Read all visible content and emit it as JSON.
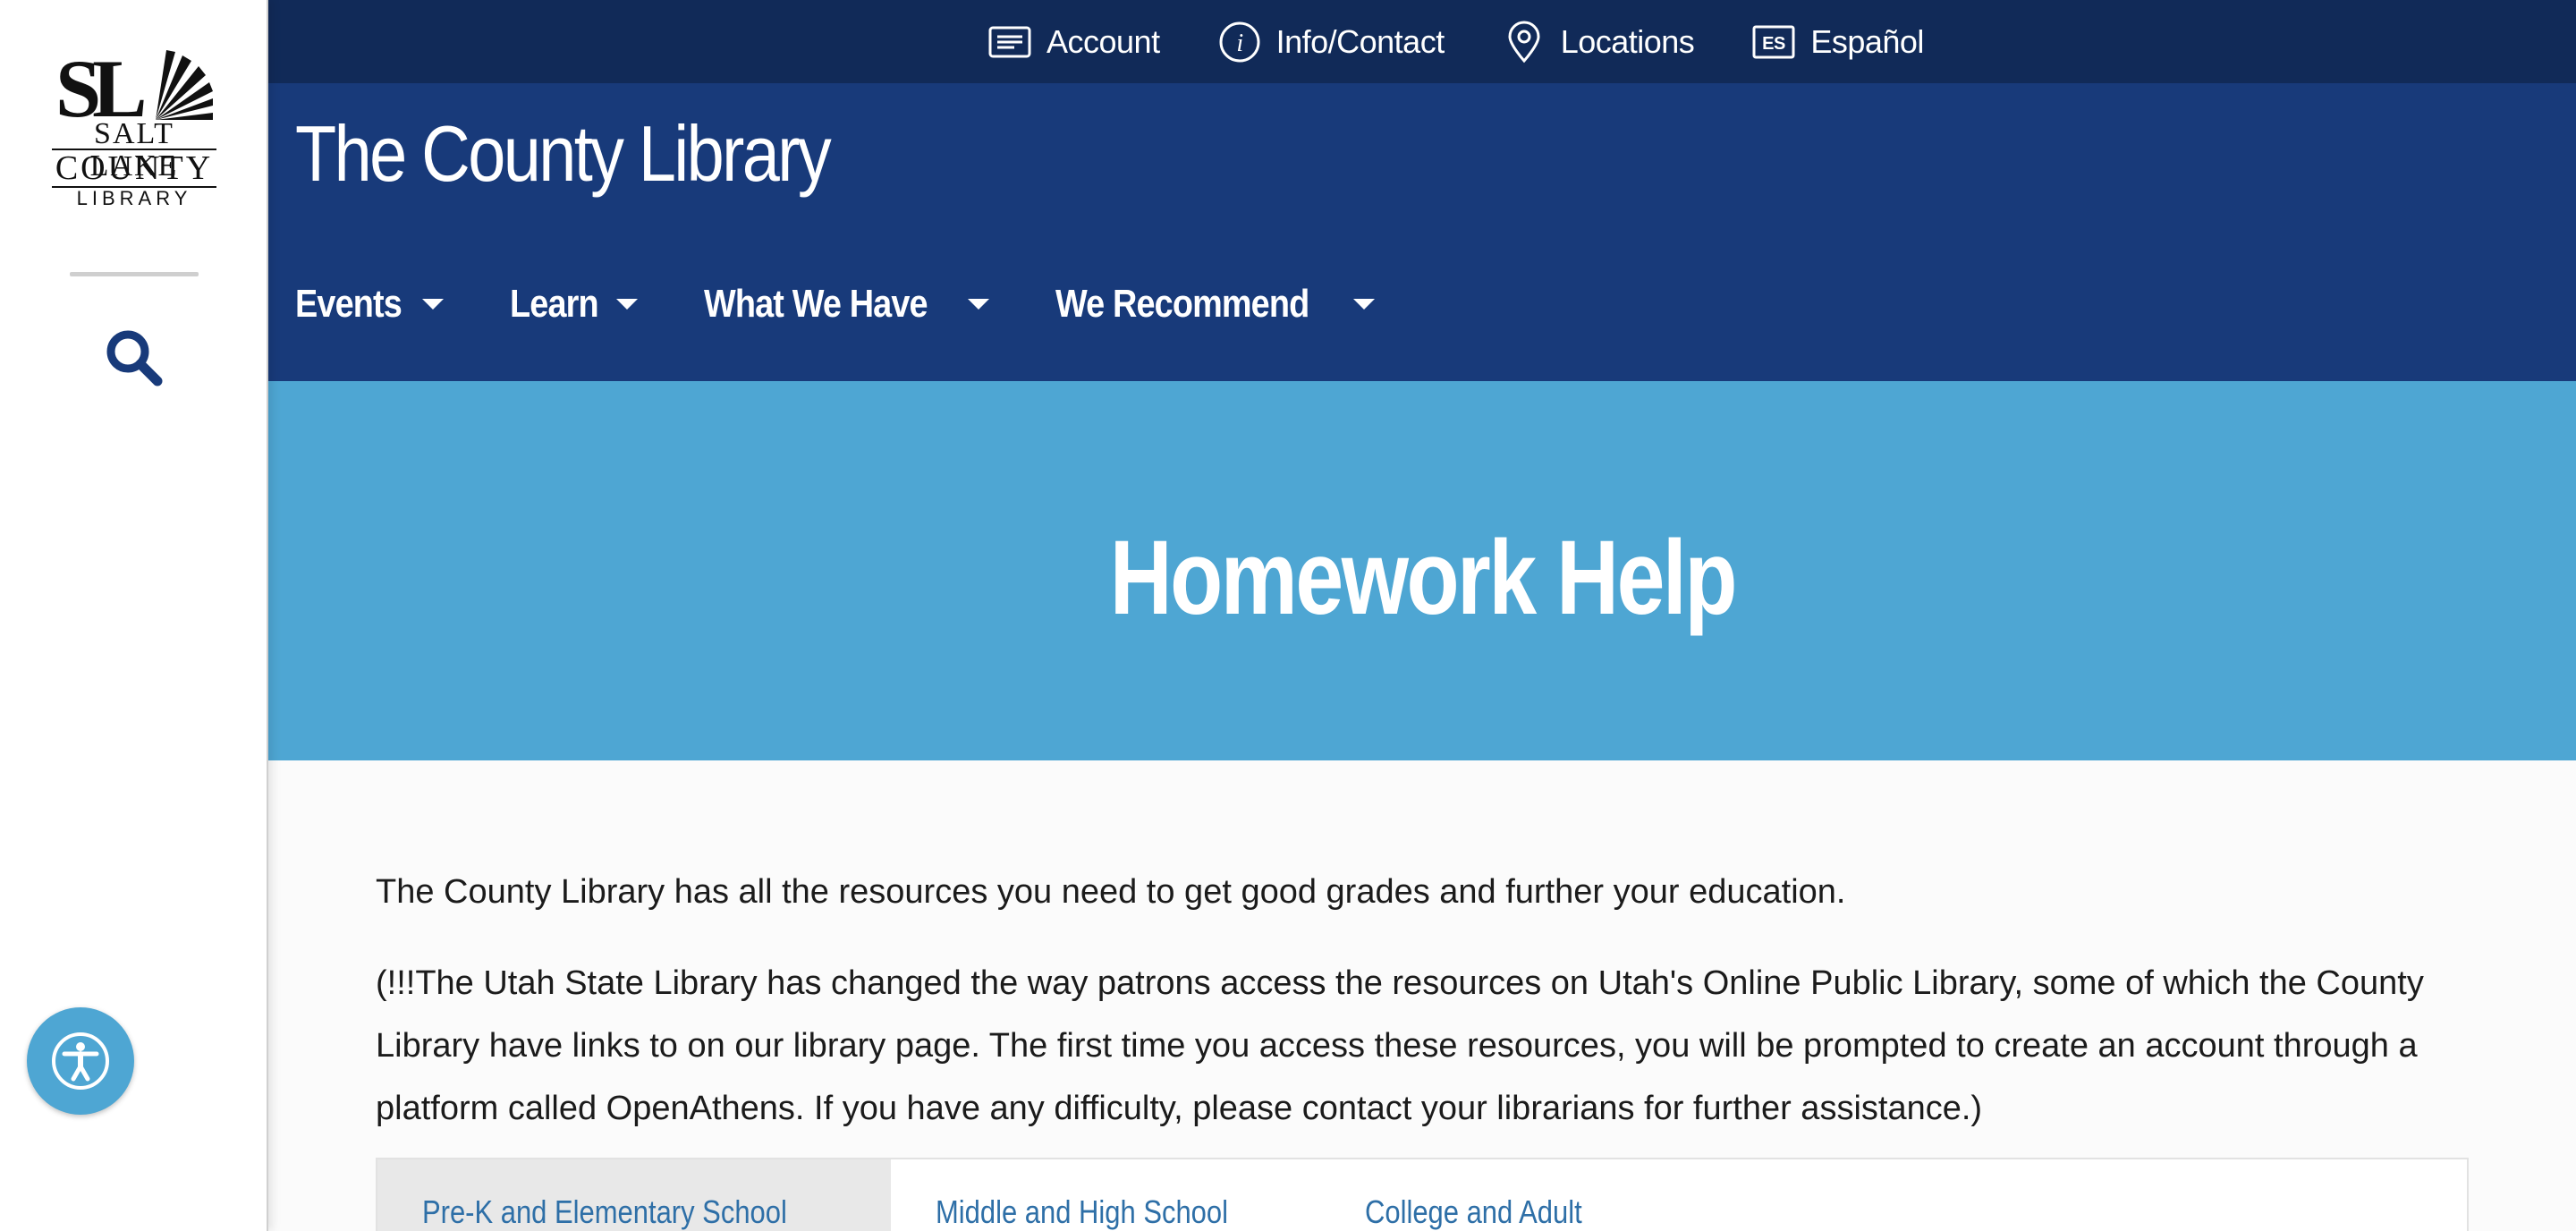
{
  "sidebar": {
    "logo": {
      "line1": "SALT LAKE",
      "line2": "COUNTY",
      "line3": "LIBRARY"
    }
  },
  "utility_nav": {
    "items": [
      {
        "label": "Account",
        "icon": "account-card-icon"
      },
      {
        "label": "Info/Contact",
        "icon": "info-icon"
      },
      {
        "label": "Locations",
        "icon": "map-pin-icon"
      },
      {
        "label": "Español",
        "icon": "es-language-icon",
        "icon_text": "ES"
      }
    ]
  },
  "header": {
    "title": "The County Library",
    "nav": [
      {
        "label": "Events"
      },
      {
        "label": "Learn"
      },
      {
        "label": "What We Have"
      },
      {
        "label": "We Recommend"
      }
    ]
  },
  "hero": {
    "title": "Homework Help"
  },
  "content": {
    "intro": "The County Library has all the resources you need to get good grades and further your education.",
    "notice": "(!!!The Utah State Library has changed the way patrons access the resources on Utah's Online Public Library, some of which the County Library have links to on our library page. The first time you access these resources, you will be prompted to create an account through a platform called OpenAthens. If you have any difficulty, please contact your librarians for further assistance.)",
    "tabs": [
      {
        "label": "Pre-K and Elementary School",
        "active": true
      },
      {
        "label": "Middle and High School",
        "active": false
      },
      {
        "label": "College and Adult",
        "active": false
      }
    ]
  },
  "colors": {
    "utility_bar": "#112a58",
    "header": "#183a7a",
    "hero": "#4ea6d3",
    "tab_link": "#2e6fa7"
  }
}
